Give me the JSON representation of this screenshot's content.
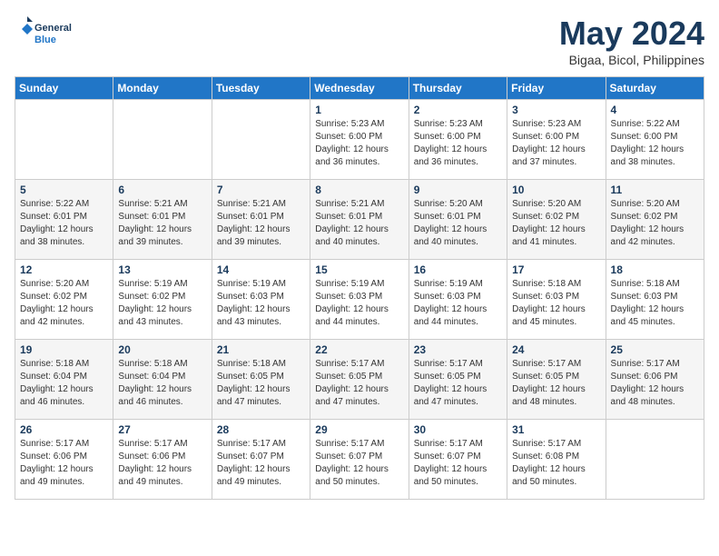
{
  "header": {
    "logo_line1": "General",
    "logo_line2": "Blue",
    "month": "May 2024",
    "location": "Bigaa, Bicol, Philippines"
  },
  "weekdays": [
    "Sunday",
    "Monday",
    "Tuesday",
    "Wednesday",
    "Thursday",
    "Friday",
    "Saturday"
  ],
  "weeks": [
    [
      {
        "day": "",
        "info": ""
      },
      {
        "day": "",
        "info": ""
      },
      {
        "day": "",
        "info": ""
      },
      {
        "day": "1",
        "info": "Sunrise: 5:23 AM\nSunset: 6:00 PM\nDaylight: 12 hours\nand 36 minutes."
      },
      {
        "day": "2",
        "info": "Sunrise: 5:23 AM\nSunset: 6:00 PM\nDaylight: 12 hours\nand 36 minutes."
      },
      {
        "day": "3",
        "info": "Sunrise: 5:23 AM\nSunset: 6:00 PM\nDaylight: 12 hours\nand 37 minutes."
      },
      {
        "day": "4",
        "info": "Sunrise: 5:22 AM\nSunset: 6:00 PM\nDaylight: 12 hours\nand 38 minutes."
      }
    ],
    [
      {
        "day": "5",
        "info": "Sunrise: 5:22 AM\nSunset: 6:01 PM\nDaylight: 12 hours\nand 38 minutes."
      },
      {
        "day": "6",
        "info": "Sunrise: 5:21 AM\nSunset: 6:01 PM\nDaylight: 12 hours\nand 39 minutes."
      },
      {
        "day": "7",
        "info": "Sunrise: 5:21 AM\nSunset: 6:01 PM\nDaylight: 12 hours\nand 39 minutes."
      },
      {
        "day": "8",
        "info": "Sunrise: 5:21 AM\nSunset: 6:01 PM\nDaylight: 12 hours\nand 40 minutes."
      },
      {
        "day": "9",
        "info": "Sunrise: 5:20 AM\nSunset: 6:01 PM\nDaylight: 12 hours\nand 40 minutes."
      },
      {
        "day": "10",
        "info": "Sunrise: 5:20 AM\nSunset: 6:02 PM\nDaylight: 12 hours\nand 41 minutes."
      },
      {
        "day": "11",
        "info": "Sunrise: 5:20 AM\nSunset: 6:02 PM\nDaylight: 12 hours\nand 42 minutes."
      }
    ],
    [
      {
        "day": "12",
        "info": "Sunrise: 5:20 AM\nSunset: 6:02 PM\nDaylight: 12 hours\nand 42 minutes."
      },
      {
        "day": "13",
        "info": "Sunrise: 5:19 AM\nSunset: 6:02 PM\nDaylight: 12 hours\nand 43 minutes."
      },
      {
        "day": "14",
        "info": "Sunrise: 5:19 AM\nSunset: 6:03 PM\nDaylight: 12 hours\nand 43 minutes."
      },
      {
        "day": "15",
        "info": "Sunrise: 5:19 AM\nSunset: 6:03 PM\nDaylight: 12 hours\nand 44 minutes."
      },
      {
        "day": "16",
        "info": "Sunrise: 5:19 AM\nSunset: 6:03 PM\nDaylight: 12 hours\nand 44 minutes."
      },
      {
        "day": "17",
        "info": "Sunrise: 5:18 AM\nSunset: 6:03 PM\nDaylight: 12 hours\nand 45 minutes."
      },
      {
        "day": "18",
        "info": "Sunrise: 5:18 AM\nSunset: 6:03 PM\nDaylight: 12 hours\nand 45 minutes."
      }
    ],
    [
      {
        "day": "19",
        "info": "Sunrise: 5:18 AM\nSunset: 6:04 PM\nDaylight: 12 hours\nand 46 minutes."
      },
      {
        "day": "20",
        "info": "Sunrise: 5:18 AM\nSunset: 6:04 PM\nDaylight: 12 hours\nand 46 minutes."
      },
      {
        "day": "21",
        "info": "Sunrise: 5:18 AM\nSunset: 6:05 PM\nDaylight: 12 hours\nand 47 minutes."
      },
      {
        "day": "22",
        "info": "Sunrise: 5:17 AM\nSunset: 6:05 PM\nDaylight: 12 hours\nand 47 minutes."
      },
      {
        "day": "23",
        "info": "Sunrise: 5:17 AM\nSunset: 6:05 PM\nDaylight: 12 hours\nand 47 minutes."
      },
      {
        "day": "24",
        "info": "Sunrise: 5:17 AM\nSunset: 6:05 PM\nDaylight: 12 hours\nand 48 minutes."
      },
      {
        "day": "25",
        "info": "Sunrise: 5:17 AM\nSunset: 6:06 PM\nDaylight: 12 hours\nand 48 minutes."
      }
    ],
    [
      {
        "day": "26",
        "info": "Sunrise: 5:17 AM\nSunset: 6:06 PM\nDaylight: 12 hours\nand 49 minutes."
      },
      {
        "day": "27",
        "info": "Sunrise: 5:17 AM\nSunset: 6:06 PM\nDaylight: 12 hours\nand 49 minutes."
      },
      {
        "day": "28",
        "info": "Sunrise: 5:17 AM\nSunset: 6:07 PM\nDaylight: 12 hours\nand 49 minutes."
      },
      {
        "day": "29",
        "info": "Sunrise: 5:17 AM\nSunset: 6:07 PM\nDaylight: 12 hours\nand 50 minutes."
      },
      {
        "day": "30",
        "info": "Sunrise: 5:17 AM\nSunset: 6:07 PM\nDaylight: 12 hours\nand 50 minutes."
      },
      {
        "day": "31",
        "info": "Sunrise: 5:17 AM\nSunset: 6:08 PM\nDaylight: 12 hours\nand 50 minutes."
      },
      {
        "day": "",
        "info": ""
      }
    ]
  ]
}
